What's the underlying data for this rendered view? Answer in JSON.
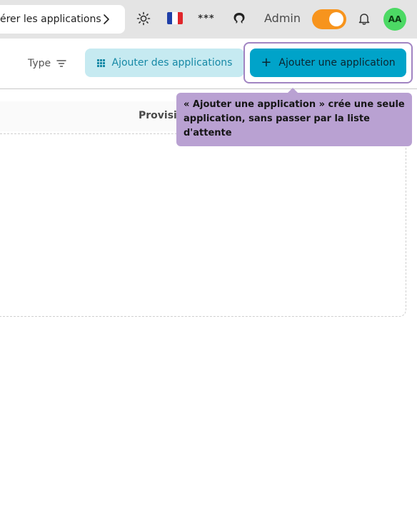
{
  "header": {
    "breadcrumb": "érer les applications",
    "admin_label": "Admin",
    "avatar_initials": "AA",
    "stars_glyph": "***",
    "flag_colors": [
      "#1f3fa8",
      "#ffffff",
      "#e0262b"
    ],
    "toggle_on": true,
    "icons": [
      "sun-icon",
      "flag-fr-icon",
      "password-icon",
      "octocat-icon",
      "bell-icon",
      "chevron-right-icon"
    ]
  },
  "toolbar": {
    "type_filter_label": "Type",
    "bulk_add_label": "Ajouter des applications",
    "add_label": "Ajouter une application"
  },
  "table": {
    "columns": [
      "Provisio"
    ]
  },
  "tooltip": {
    "text": "« Ajouter une application » crée une seule application, sans passer par la liste d'attente"
  },
  "colors": {
    "accent": "#00a3c9",
    "bulk_button": "#c6eaf1",
    "toggle": "#f7941d",
    "tooltip": "#b9a1d2",
    "avatar": "#4cd964"
  }
}
